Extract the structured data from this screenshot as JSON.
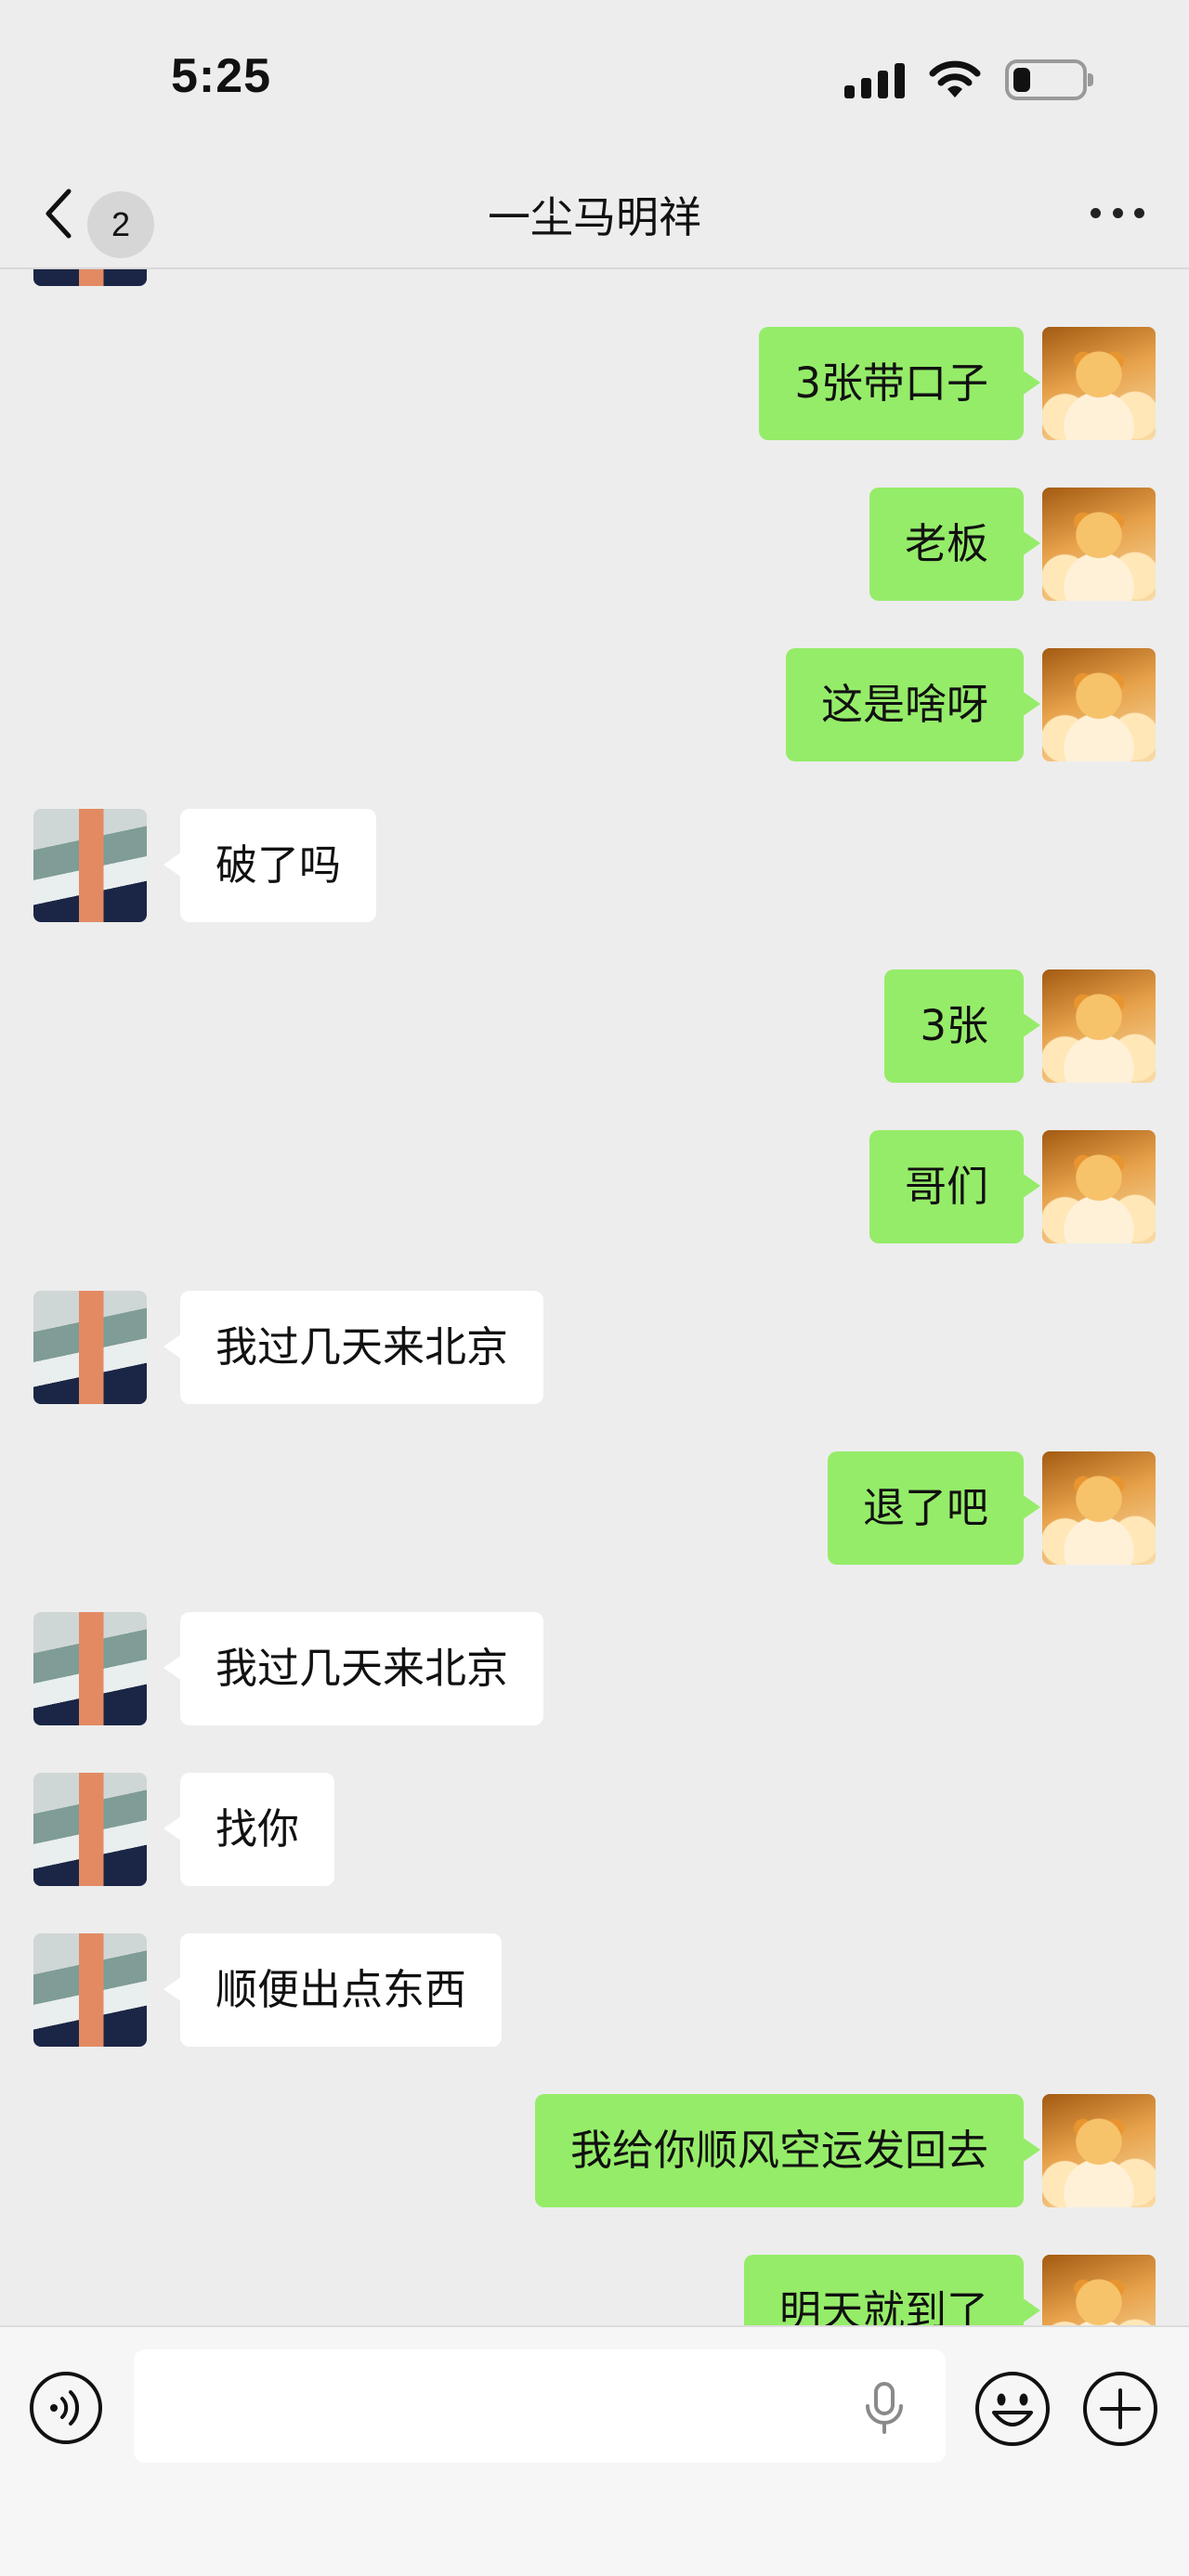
{
  "status_bar": {
    "time": "5:25",
    "battery_level": 0.25
  },
  "nav": {
    "unread_count": "2",
    "title": "一尘马明祥"
  },
  "messages": [
    {
      "side": "out",
      "text": "3张带口子",
      "avatar": "cat-avatar"
    },
    {
      "side": "out",
      "text": "老板",
      "avatar": "cat-avatar"
    },
    {
      "side": "out",
      "text": "这是啥呀",
      "avatar": "cat-avatar"
    },
    {
      "side": "in",
      "text": "破了吗",
      "avatar": "banknote-stack-avatar"
    },
    {
      "side": "out",
      "text": "3张",
      "avatar": "cat-avatar"
    },
    {
      "side": "out",
      "text": "哥们",
      "avatar": "cat-avatar"
    },
    {
      "side": "in",
      "text": "我过几天来北京",
      "avatar": "banknote-stack-avatar"
    },
    {
      "side": "out",
      "text": "退了吧",
      "avatar": "cat-avatar"
    },
    {
      "side": "in",
      "text": "我过几天来北京",
      "avatar": "banknote-stack-avatar"
    },
    {
      "side": "in",
      "text": "找你",
      "avatar": "banknote-stack-avatar"
    },
    {
      "side": "in",
      "text": "顺便出点东西",
      "avatar": "banknote-stack-avatar"
    },
    {
      "side": "out",
      "text": "我给你顺风空运发回去",
      "avatar": "cat-avatar"
    },
    {
      "side": "out",
      "text": "明天就到了",
      "avatar": "cat-avatar"
    }
  ],
  "input_bar": {
    "value": "",
    "icons": [
      "voice-icon",
      "mic-icon",
      "emoji-icon",
      "plus-icon"
    ]
  },
  "colors": {
    "outgoing_bubble": "#95ec69",
    "incoming_bubble": "#ffffff",
    "background": "#ededed"
  }
}
